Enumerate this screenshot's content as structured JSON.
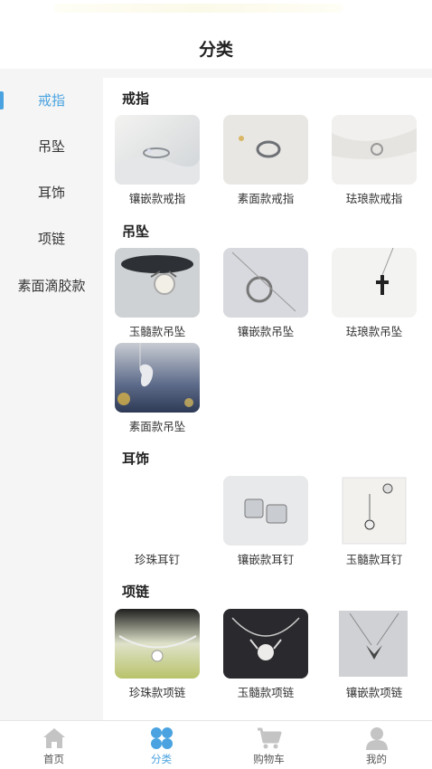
{
  "header": {
    "title": "分类"
  },
  "sidebar": {
    "items": [
      {
        "label": "戒指",
        "active": true
      },
      {
        "label": "吊坠",
        "active": false
      },
      {
        "label": "耳饰",
        "active": false
      },
      {
        "label": "项链",
        "active": false
      },
      {
        "label": "素面滴胶款",
        "active": false
      }
    ]
  },
  "sections": [
    {
      "title": "戒指",
      "items": [
        {
          "label": "镶嵌款戒指"
        },
        {
          "label": "素面款戒指"
        },
        {
          "label": "珐琅款戒指"
        }
      ]
    },
    {
      "title": "吊坠",
      "items": [
        {
          "label": "玉髓款吊坠"
        },
        {
          "label": "镶嵌款吊坠"
        },
        {
          "label": "珐琅款吊坠"
        },
        {
          "label": "素面款吊坠"
        }
      ]
    },
    {
      "title": "耳饰",
      "items": [
        {
          "label": "珍珠耳钉"
        },
        {
          "label": "镶嵌款耳钉"
        },
        {
          "label": "玉髓款耳钉"
        }
      ]
    },
    {
      "title": "项链",
      "items": [
        {
          "label": "珍珠款项链"
        },
        {
          "label": "玉髓款项链"
        },
        {
          "label": "镶嵌款项链"
        }
      ]
    }
  ],
  "tabbar": {
    "items": [
      {
        "label": "首页",
        "icon": "home-icon"
      },
      {
        "label": "分类",
        "icon": "category-icon",
        "active": true
      },
      {
        "label": "购物车",
        "icon": "cart-icon"
      },
      {
        "label": "我的",
        "icon": "user-icon"
      }
    ]
  },
  "colors": {
    "accent": "#4aa3e0",
    "inactive": "#c4c4c4",
    "sidebar_bg": "#f5f5f5"
  }
}
